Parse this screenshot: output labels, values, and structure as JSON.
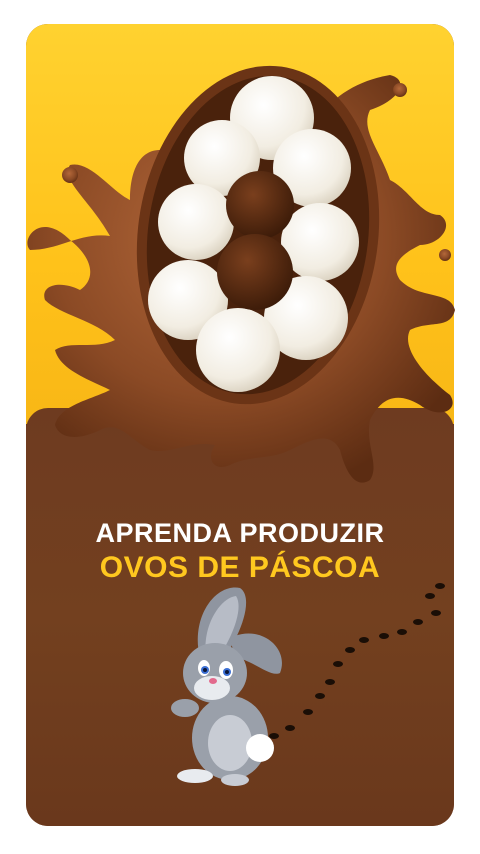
{
  "headline": {
    "line1": "APRENDA PRODUZIR",
    "line2": "OVOS DE PÁSCOA"
  },
  "colors": {
    "yellow": "#ffc21a",
    "brown": "#6e3a1e",
    "chocolate": "#8a4a26",
    "headline_white": "#ffffff",
    "headline_yellow": "#ffc81f"
  },
  "illustrations": {
    "egg": "chocolate-egg-with-truffles-icon",
    "bunny": "bunny-icon",
    "footprints": "footprints-icon"
  }
}
